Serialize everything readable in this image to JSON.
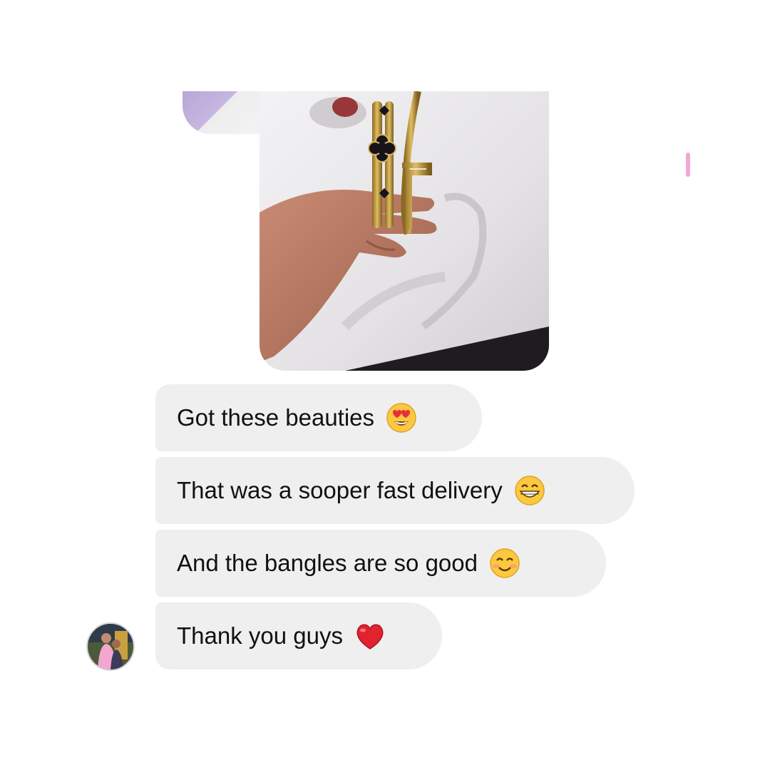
{
  "conversation": {
    "shared_photo": {
      "icon": "bangles-photo"
    },
    "messages": [
      {
        "text": "Got these beauties",
        "emoji": "heart-eyes-emoji"
      },
      {
        "text": "That was a sooper fast delivery",
        "emoji": "grinning-face-emoji"
      },
      {
        "text": "And the bangles are so good",
        "emoji": "smiling-face-emoji"
      },
      {
        "text": "Thank you guys",
        "emoji": "red-heart-emoji"
      }
    ],
    "sender_avatar": {
      "icon": "avatar"
    }
  },
  "colors": {
    "bubble_bg": "#efefef",
    "text": "#111111",
    "background": "#ffffff"
  }
}
